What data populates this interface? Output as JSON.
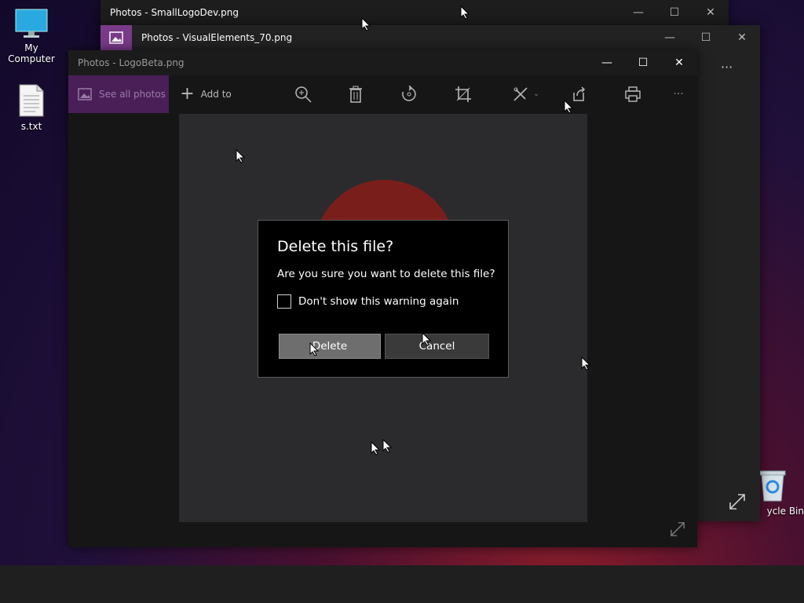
{
  "desktop": {
    "icons": [
      {
        "label": "My Computer"
      },
      {
        "label": "s.txt"
      },
      {
        "label": "ycle Bin"
      }
    ]
  },
  "windows": {
    "back": {
      "title": "Photos - SmallLogoDev.png"
    },
    "middle": {
      "title": "Photos - VisualElements_70.png"
    },
    "front": {
      "title": "Photos - LogoBeta.png"
    }
  },
  "toolbar": {
    "see_all_photos": "See all photos",
    "add_to": "Add to",
    "more": "···"
  },
  "dialog": {
    "title": "Delete this file?",
    "message": "Are you sure you want to delete this file?",
    "checkbox_label": "Don't show this warning again",
    "checkbox_checked": false,
    "delete_label": "Delete",
    "cancel_label": "Cancel"
  },
  "colors": {
    "accent": "#6b2d7a",
    "dialog_bg": "#000000",
    "delete_button": "#6e6e6e",
    "cancel_button": "#3a3a3a"
  }
}
